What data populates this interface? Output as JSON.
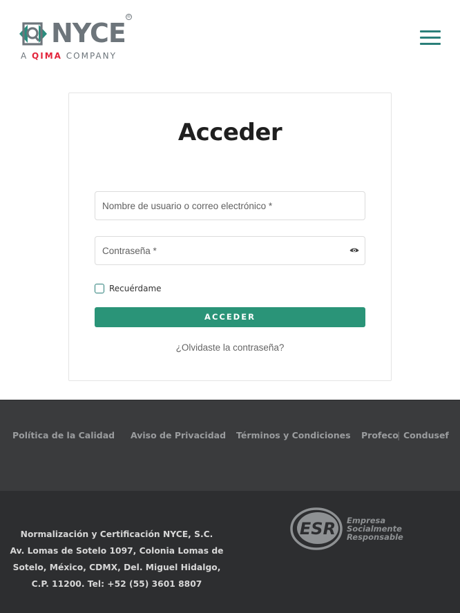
{
  "header": {
    "logo": {
      "word": "NYCE",
      "registered": "®",
      "sub_prefix": "A",
      "sub_brand": "QIMA",
      "sub_suffix": "COMPANY"
    },
    "menu_icon": "hamburger-menu-icon"
  },
  "login": {
    "title": "Acceder",
    "username_placeholder": "Nombre de usuario o correo electrónico *",
    "password_placeholder": "Contraseña *",
    "password_toggle_icon": "eye-icon",
    "remember_label": "Recuérdame",
    "submit_label": "ACCEDER",
    "forgot_label": "¿Olvidaste la contraseña?"
  },
  "footer": {
    "links": [
      {
        "label": "Política de la Calidad"
      },
      {
        "label": "Aviso de Privacidad"
      },
      {
        "label": "Términos y Condiciones"
      },
      {
        "label": "Profeco"
      },
      {
        "label": "Condusef"
      }
    ],
    "link_separator": "|",
    "address_lines": [
      "Normalización y Certificación NYCE, S.C.",
      "Av. Lomas de Sotelo 1097, Colonia Lomas de",
      "Sotelo, México, CDMX, Del. Miguel Hidalgo,",
      "C.P. 11200. Tel: +52 (55) 3601 8807"
    ],
    "esr": {
      "badge": "ESR",
      "line1": "Empresa",
      "line2": "Socialmente",
      "line3": "Responsable"
    }
  },
  "colors": {
    "accent": "#2a9478",
    "brand_teal": "#2a7f79",
    "qima_red": "#e3243b",
    "footer_links_bg": "#3a3b3d",
    "footer_bottom_bg": "#2d2e30"
  }
}
